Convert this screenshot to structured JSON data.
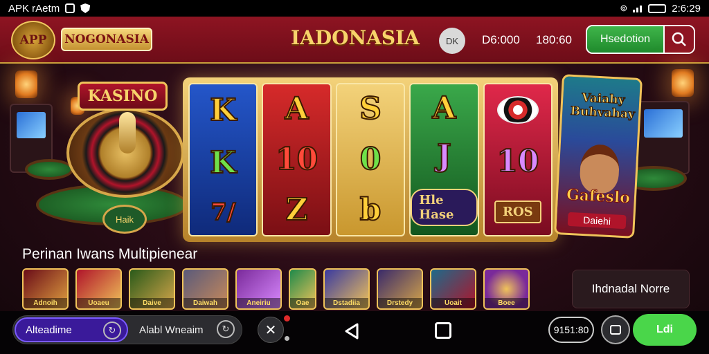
{
  "statusbar": {
    "app_label": "APK rAetm",
    "time": "2:6:29"
  },
  "header": {
    "logo_text": "APP",
    "brand": "NOGONASIA",
    "title": "IADONASIA",
    "chip": "DK",
    "stat1": "D6:000",
    "stat2": "180:60",
    "select_label": "Hsedotion"
  },
  "kasino": {
    "banner": "KASINO",
    "sign": "Haik"
  },
  "reels": [
    [
      "K",
      "K",
      "7/"
    ],
    [
      "A",
      "10",
      "Z"
    ],
    [
      "S",
      "0",
      "b"
    ],
    [
      "A",
      "J",
      "Hle Hase"
    ],
    [
      "10",
      "ROS"
    ]
  ],
  "poster": {
    "title": "Vaiahy Buhvahay",
    "subtitle": "Gafeslo",
    "tag": "Daiehi"
  },
  "section_title": "Perinan Iwans Multipienear",
  "games": [
    "Adnoih",
    "Uoaeu",
    "Daive",
    "Daiwah",
    "Aneiriu",
    "Oae",
    "Dstadiia",
    "Drstedy",
    "Uoait",
    "Boee"
  ],
  "info_card": "Ihdnadal Norre",
  "bottom": {
    "pill_active": "Alteadime",
    "pill_right": "Alabl Wneaim",
    "coord": "9151:80",
    "go": "Ldi"
  }
}
